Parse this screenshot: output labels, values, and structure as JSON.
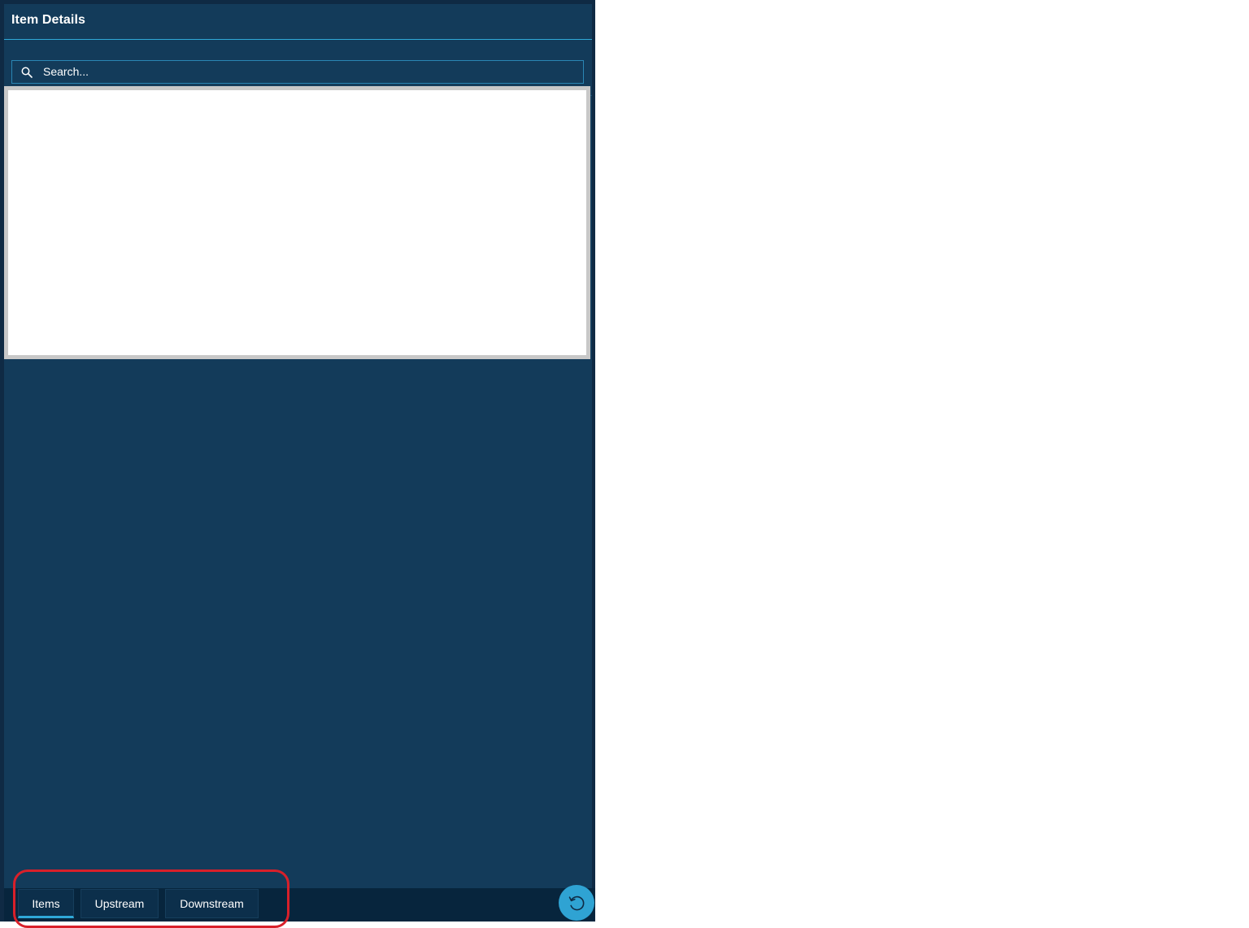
{
  "panel": {
    "title": "Item Details"
  },
  "search": {
    "placeholder": "Search..."
  },
  "tabs": [
    {
      "label": "Items",
      "active": true
    },
    {
      "label": "Upstream",
      "active": false
    },
    {
      "label": "Downstream",
      "active": false
    }
  ],
  "icons": {
    "search": "search-icon",
    "refresh": "refresh-icon"
  },
  "colors": {
    "panel_background": "#133b5a",
    "accent": "#2fa8d8",
    "annotation": "#d8202a"
  }
}
